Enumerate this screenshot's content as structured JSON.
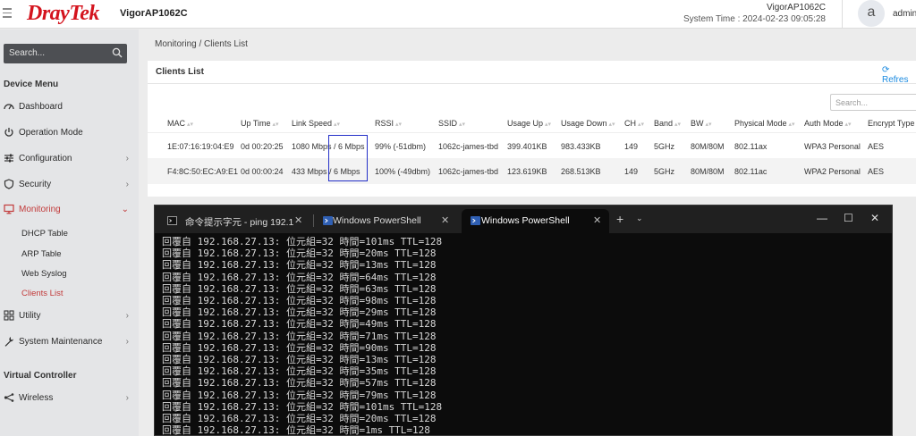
{
  "header": {
    "logo": "DrayTek",
    "model": "VigorAP1062C",
    "system_name": "VigorAP1062C",
    "system_time": "System Time : 2024-02-23 09:05:28",
    "avatar_letter": "a",
    "user": "admin"
  },
  "sidebar": {
    "search_placeholder": "Search...",
    "device_menu_title": "Device Menu",
    "items": [
      {
        "label": "Dashboard",
        "icon": "dashboard-icon"
      },
      {
        "label": "Operation Mode",
        "icon": "power-icon"
      },
      {
        "label": "Configuration",
        "icon": "sliders-icon"
      },
      {
        "label": "Security",
        "icon": "shield-icon"
      },
      {
        "label": "Monitoring",
        "icon": "monitor-icon"
      },
      {
        "label": "Utility",
        "icon": "grid-icon"
      },
      {
        "label": "System Maintenance",
        "icon": "wrench-icon"
      }
    ],
    "monitoring_sub": [
      "DHCP Table",
      "ARP Table",
      "Web Syslog",
      "Clients List"
    ],
    "virtual_controller_title": "Virtual Controller",
    "wireless_label": "Wireless",
    "accent_color": "#c23b3b"
  },
  "breadcrumb": "Monitoring / Clients List",
  "clients": {
    "title": "Clients List",
    "refresh_label": "Refres",
    "search_placeholder": "Search...",
    "columns": [
      "MAC",
      "Up Time",
      "Link Speed",
      "RSSI",
      "SSID",
      "Usage Up",
      "Usage Down",
      "CH",
      "Band",
      "BW",
      "Physical Mode",
      "Auth Mode",
      "Encrypt Type"
    ],
    "rows": [
      [
        "1E:07:16:19:04:E9",
        "0d 00:20:25",
        "1080 Mbps / 6 Mbps",
        "99% (-51dbm)",
        "1062c-james-tbd",
        "399.401KB",
        "983.433KB",
        "149",
        "5GHz",
        "80M/80M",
        "802.11ax",
        "WPA3 Personal",
        "AES"
      ],
      [
        "F4:8C:50:EC:A9:E1",
        "0d 00:00:24",
        "433 Mbps / 6 Mbps",
        "100% (-49dbm)",
        "1062c-james-tbd",
        "123.619KB",
        "268.513KB",
        "149",
        "5GHz",
        "80M/80M",
        "802.11ac",
        "WPA2 Personal",
        "AES"
      ]
    ]
  },
  "terminal": {
    "tabs": [
      "命令提示字元 - ping  192.1",
      "Windows PowerShell",
      "Windows PowerShell"
    ],
    "lines": [
      "回覆自 192.168.27.13: 位元組=32 時間=101ms TTL=128",
      "回覆自 192.168.27.13: 位元組=32 時間=20ms TTL=128",
      "回覆自 192.168.27.13: 位元組=32 時間=13ms TTL=128",
      "回覆自 192.168.27.13: 位元組=32 時間=64ms TTL=128",
      "回覆自 192.168.27.13: 位元組=32 時間=63ms TTL=128",
      "回覆自 192.168.27.13: 位元組=32 時間=98ms TTL=128",
      "回覆自 192.168.27.13: 位元組=32 時間=29ms TTL=128",
      "回覆自 192.168.27.13: 位元組=32 時間=49ms TTL=128",
      "回覆自 192.168.27.13: 位元組=32 時間=71ms TTL=128",
      "回覆自 192.168.27.13: 位元組=32 時間=90ms TTL=128",
      "回覆自 192.168.27.13: 位元組=32 時間=13ms TTL=128",
      "回覆自 192.168.27.13: 位元組=32 時間=35ms TTL=128",
      "回覆自 192.168.27.13: 位元組=32 時間=57ms TTL=128",
      "回覆自 192.168.27.13: 位元組=32 時間=79ms TTL=128",
      "回覆自 192.168.27.13: 位元組=32 時間=101ms TTL=128",
      "回覆自 192.168.27.13: 位元組=32 時間=20ms TTL=128",
      "回覆自 192.168.27.13: 位元組=32 時間=1ms TTL=128"
    ]
  }
}
